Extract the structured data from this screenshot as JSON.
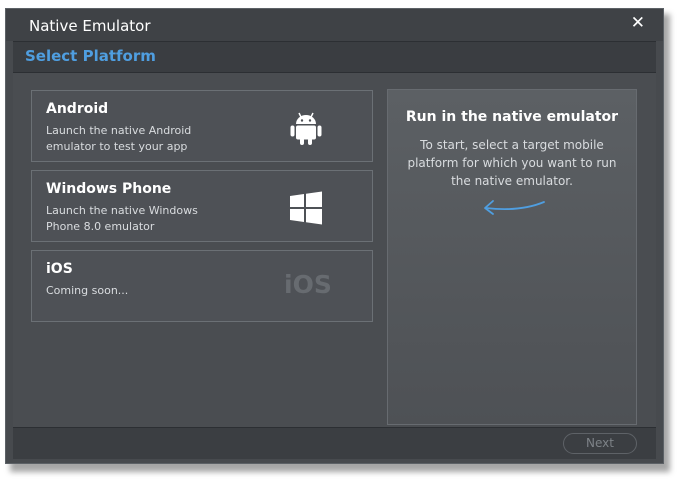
{
  "window": {
    "title": "Native Emulator",
    "close_glyph": "✕"
  },
  "header": {
    "subtitle": "Select Platform"
  },
  "platforms": [
    {
      "title": "Android",
      "description": "Launch the native Android emulator to test your app",
      "icon": "android-icon"
    },
    {
      "title": "Windows Phone",
      "description": "Launch the native Windows Phone 8.0 emulator",
      "icon": "windows-icon"
    },
    {
      "title": "iOS",
      "description": "Coming soon...",
      "icon_text": "iOS"
    }
  ],
  "info_panel": {
    "title": "Run in the native emulator",
    "text": "To start, select a target mobile platform for which you want to run the native emulator."
  },
  "footer": {
    "next_label": "Next",
    "next_enabled": false
  },
  "colors": {
    "accent": "#4f9ee0",
    "window_bg": "#474a4e"
  }
}
